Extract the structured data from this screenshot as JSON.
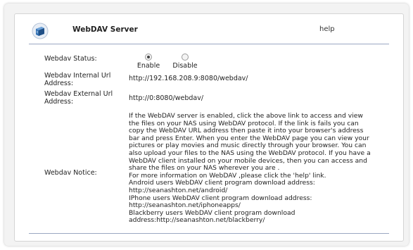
{
  "header": {
    "title": "WebDAV Server",
    "help": "help",
    "icon": "network-drive-icon"
  },
  "status": {
    "label": "Webdav Status:",
    "options": [
      {
        "label": "Enable",
        "checked": true
      },
      {
        "label": "Disable",
        "checked": false
      }
    ]
  },
  "internal_url": {
    "label_line1": "Webdav Internal Url",
    "label_line2": "Address:",
    "value": "http://192.168.208.9:8080/webdav/"
  },
  "external_url": {
    "label_line1": "Webdav External Url",
    "label_line2": "Address:",
    "value": "http://0:8080/webdav/"
  },
  "notice": {
    "label": "Webdav Notice:",
    "lines": [
      "If the WebDAV server is enabled, click the above link to access and view",
      "the files on your NAS using WebDAV protocol. If the link is fails you can",
      "copy the WebDAV URL address then paste it into your browser's address",
      "bar and press Enter. When you enter the WebDAV page you can view your",
      "pictures or play movies and music directly through your browser. You can",
      "also upload your files to the NAS using the WebDAV protocol. If you have a",
      "WebDAV client installed on your mobile devices, then you can access and",
      "share the files on your NAS wherever you are .",
      "For more information on WebDAV ,please click the 'help' link.",
      "Android users WebDAV client program download address:"
    ],
    "android_link": "http://seanashton.net/android/",
    "iphone_text": "IPhone users WebDAV client program download address:",
    "iphone_link": "http://seanashton.net/iphoneapps/",
    "blackberry_text": "Blackberry users WebDAV client program download",
    "blackberry_prefix": "address:",
    "blackberry_link": "http://seanashton.net/blackberry/"
  },
  "colors": {
    "frame": "#f3f3f3",
    "divider": "#9aa7c2",
    "icon_blue": "#2f6fb3"
  }
}
